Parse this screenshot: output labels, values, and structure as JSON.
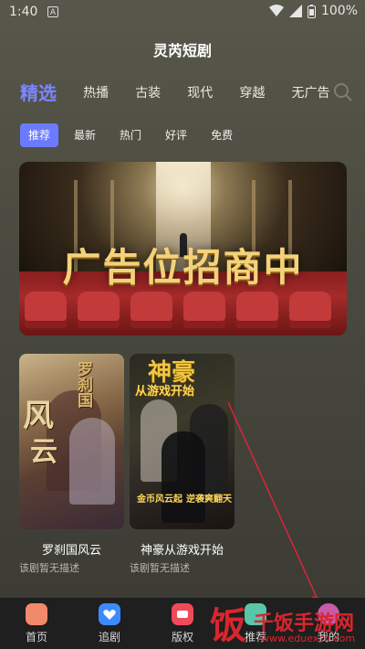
{
  "status": {
    "time": "1:40",
    "badge": "A",
    "battery": "100%"
  },
  "app": {
    "title": "灵芮短剧"
  },
  "categories": [
    "精选",
    "热播",
    "古装",
    "现代",
    "穿越",
    "无广告"
  ],
  "filters": [
    "推荐",
    "最新",
    "热门",
    "好评",
    "免费"
  ],
  "banner": {
    "text": "广告位招商中"
  },
  "dramas": [
    {
      "title": "罗刹国风云",
      "desc": "该剧暂无描述",
      "poster_text": [
        "风",
        "云",
        "罗刹国"
      ]
    },
    {
      "title": "神豪从游戏开始",
      "desc": "该剧暂无描述",
      "poster_text": [
        "神豪",
        "从游戏开始",
        "金币风云起",
        "逆袭爽翻天"
      ]
    }
  ],
  "tabbar": [
    "首页",
    "追剧",
    "版权",
    "推荐",
    "我的"
  ],
  "watermark": {
    "logo": "饭",
    "name": "千饭手游网",
    "url": "www.eduexch.com"
  },
  "colors": {
    "accent": "#6b7bff",
    "tab_home": "#f08a6a",
    "tab_follow": "#3b8bff",
    "tab_copyright": "#f04a5a",
    "tab_recommend": "#58c6a8",
    "tab_mine": "#c85aa8",
    "watermark_red": "#d9262e"
  }
}
